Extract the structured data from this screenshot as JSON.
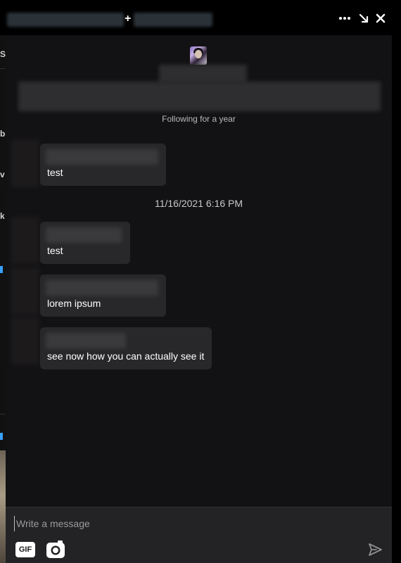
{
  "titlebar": {
    "participant_separator": "+",
    "icons": {
      "more": "more-horizontal-icon",
      "minimize": "minimize-arrow-icon",
      "close": "close-icon"
    }
  },
  "conversation": {
    "following_status": "Following for a year",
    "timestamp": "11/16/2021 6:16 PM",
    "messages": [
      {
        "text": "test"
      },
      {
        "text": "test"
      },
      {
        "text": "lorem ipsum"
      },
      {
        "text": "see now how you can actually see it"
      }
    ]
  },
  "composer": {
    "placeholder": "Write a message",
    "gif_label": "GIF",
    "icons": {
      "camera": "camera-icon",
      "send": "send-icon"
    }
  },
  "colors": {
    "panel_bg": "#121214",
    "bubble_bg": "#28282a",
    "composer_bg": "#232325",
    "titlebar_bg": "#000000"
  }
}
